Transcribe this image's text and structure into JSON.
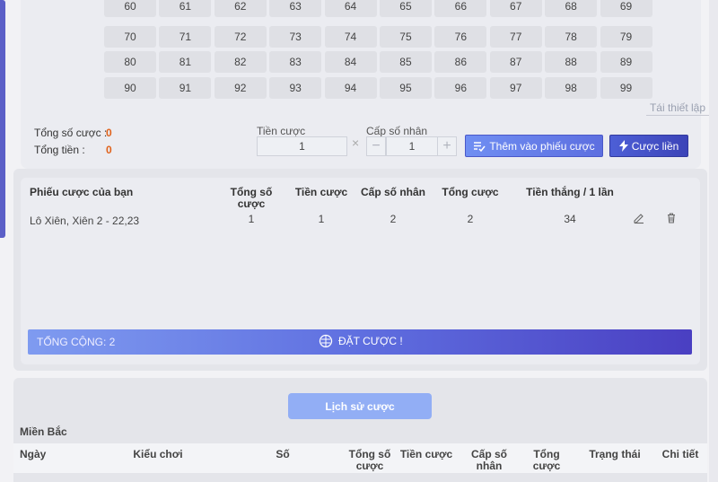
{
  "number_grid": {
    "rows": [
      [
        "60",
        "61",
        "62",
        "63",
        "64",
        "65",
        "66",
        "67",
        "68",
        "69"
      ],
      [
        "70",
        "71",
        "72",
        "73",
        "74",
        "75",
        "76",
        "77",
        "78",
        "79"
      ],
      [
        "80",
        "81",
        "82",
        "83",
        "84",
        "85",
        "86",
        "87",
        "88",
        "89"
      ],
      [
        "90",
        "91",
        "92",
        "93",
        "94",
        "95",
        "96",
        "97",
        "98",
        "99"
      ]
    ],
    "reset_label": "Tái thiết lập"
  },
  "summary": {
    "total_bets_label": "Tổng số cược :",
    "total_bets_value": "0",
    "total_money_label": "Tổng tiền :",
    "total_money_value": "0"
  },
  "bet_form": {
    "stake_label": "Tiền cược",
    "stake_value": "1",
    "multiplier_label": "Cấp số nhân",
    "multiplier_value": "1",
    "minus": "−",
    "plus": "+",
    "times": "×",
    "add_button_label": "Thêm vào phiếu cược",
    "fast_bet_label": "Cược liền"
  },
  "bet_slip": {
    "headers": {
      "slip": "Phiếu cược của bạn",
      "total_bets": "Tổng số cược",
      "stake": "Tiền cược",
      "multiplier": "Cấp số nhân",
      "total_stake": "Tổng cược",
      "win": "Tiền thắng / 1 lần"
    },
    "rows": [
      {
        "name": "Lô Xiên, Xiên 2 - 22,23",
        "total_bets": "1",
        "stake": "1",
        "multiplier": "2",
        "total_stake": "2",
        "win": "34"
      }
    ],
    "total_label": "TỔNG CỘNG: 2",
    "place_bet_label": "ĐẶT CƯỢC !"
  },
  "history": {
    "button_label": "Lịch sử cược",
    "region": "Miền Bắc",
    "headers": [
      "Ngày",
      "Kiểu chơi",
      "Số",
      "Tổng số cược",
      "Tiền cược",
      "Cấp số nhân",
      "Tổng cược",
      "Trạng thái",
      "Chi tiết"
    ]
  },
  "colors": {
    "accent": "#5b5fc7",
    "value_orange": "#e0621b"
  }
}
